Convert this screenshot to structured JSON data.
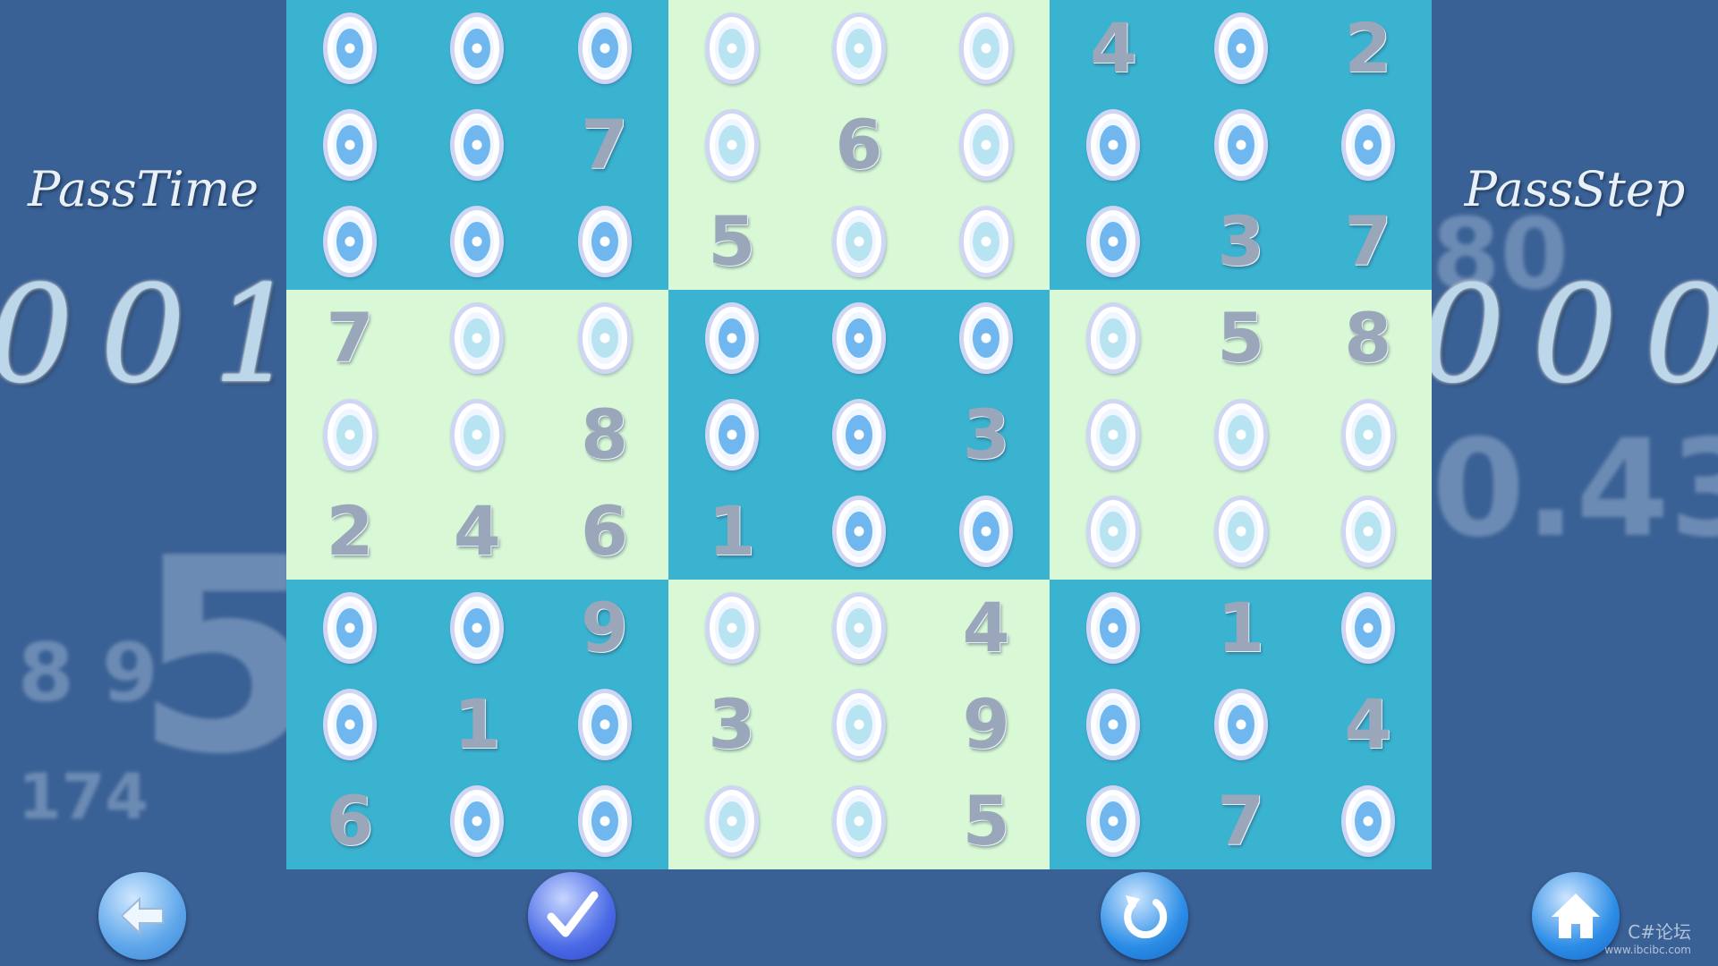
{
  "left_panel": {
    "title": "PassTime",
    "digits": [
      "0",
      "0",
      "1"
    ]
  },
  "right_panel": {
    "title": "PassStep",
    "digits": [
      "0",
      "0",
      "0"
    ]
  },
  "board": [
    [
      0,
      0,
      0,
      0,
      0,
      0,
      4,
      0,
      2
    ],
    [
      0,
      0,
      7,
      0,
      6,
      0,
      0,
      0,
      0
    ],
    [
      0,
      0,
      0,
      5,
      0,
      0,
      0,
      3,
      7
    ],
    [
      7,
      0,
      0,
      0,
      0,
      0,
      0,
      5,
      8
    ],
    [
      0,
      0,
      8,
      0,
      0,
      3,
      0,
      0,
      0
    ],
    [
      2,
      4,
      6,
      1,
      0,
      0,
      0,
      0,
      0
    ],
    [
      0,
      0,
      9,
      0,
      0,
      4,
      0,
      1,
      0
    ],
    [
      0,
      1,
      0,
      3,
      0,
      9,
      0,
      0,
      4
    ],
    [
      6,
      0,
      0,
      0,
      0,
      5,
      0,
      7,
      0
    ]
  ],
  "block_shading": [
    "dark",
    "light",
    "dark",
    "light",
    "dark",
    "light",
    "dark",
    "light",
    "dark"
  ],
  "buttons": {
    "back": "back-arrow-icon",
    "check": "checkmark-icon",
    "reset": "refresh-icon",
    "home": "home-icon"
  },
  "watermark": {
    "main": "C#论坛",
    "sub": "www.ibcibc.com"
  }
}
